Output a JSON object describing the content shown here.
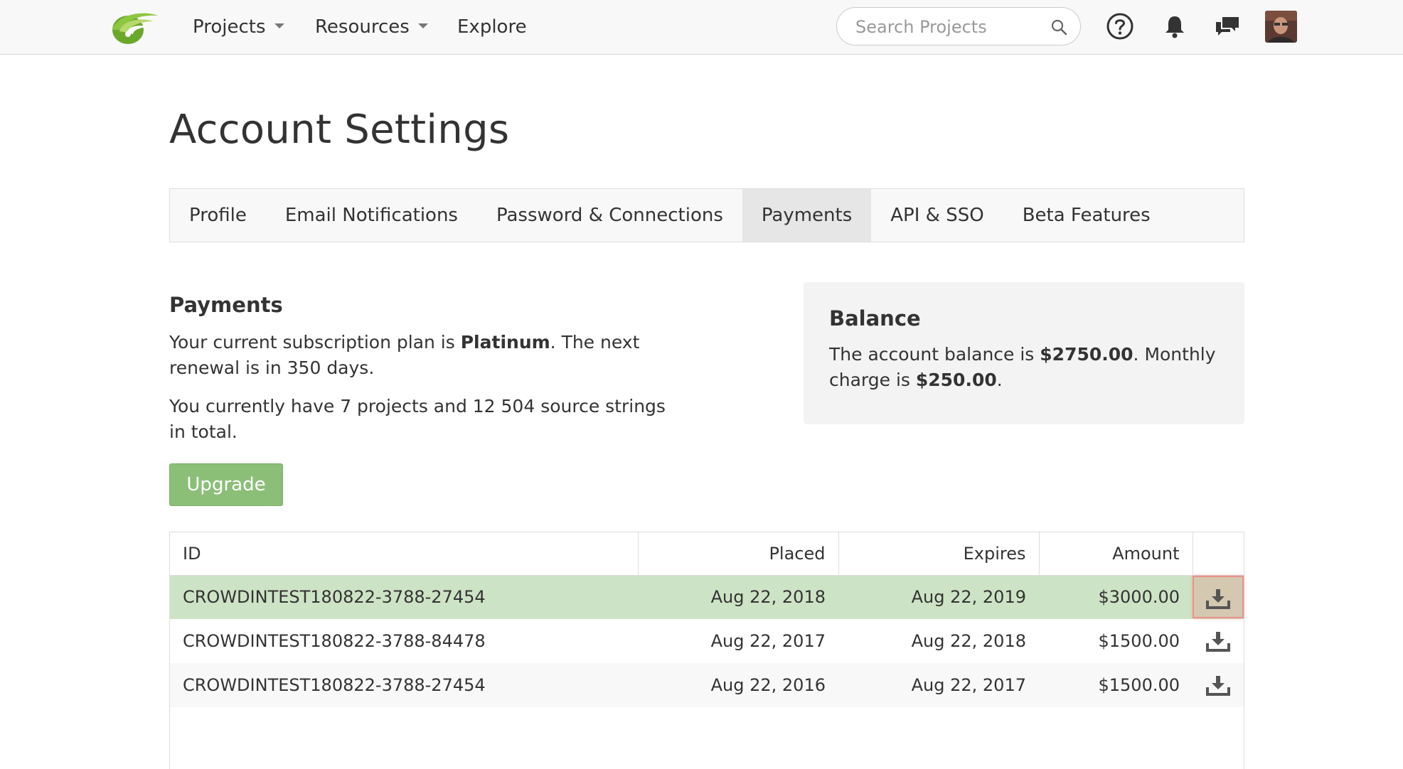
{
  "nav": {
    "projects_label": "Projects",
    "resources_label": "Resources",
    "explore_label": "Explore",
    "search_placeholder": "Search Projects",
    "logo_icon": "crowdin-logo",
    "icons": [
      "help-icon",
      "bell-icon",
      "chat-icon",
      "avatar"
    ]
  },
  "page": {
    "title": "Account Settings"
  },
  "tabs": [
    {
      "label": "Profile",
      "active": false
    },
    {
      "label": "Email Notifications",
      "active": false
    },
    {
      "label": "Password & Connections",
      "active": false
    },
    {
      "label": "Payments",
      "active": true
    },
    {
      "label": "API & SSO",
      "active": false
    },
    {
      "label": "Beta Features",
      "active": false
    }
  ],
  "payments": {
    "title": "Payments",
    "plan_prefix": "Your current subscription plan is ",
    "plan_name": "Platinum",
    "plan_suffix": ". The next renewal is in 350 days.",
    "usage_text": "You currently have 7 projects and 12 504 source strings in total.",
    "upgrade_label": "Upgrade"
  },
  "balance": {
    "title": "Balance",
    "prefix": "The account balance is ",
    "amount": "$2750.00",
    "middle": ". Monthly charge is ",
    "monthly": "$250.00",
    "suffix": "."
  },
  "table": {
    "headers": {
      "id": "ID",
      "placed": "Placed",
      "expires": "Expires",
      "amount": "Amount"
    },
    "rows": [
      {
        "id": "CROWDINTEST180822-3788-27454",
        "placed": "Aug 22, 2018",
        "expires": "Aug 22, 2019",
        "amount": "$3000.00"
      },
      {
        "id": "CROWDINTEST180822-3788-84478",
        "placed": "Aug 22, 2017",
        "expires": "Aug 22, 2018",
        "amount": "$1500.00"
      },
      {
        "id": "CROWDINTEST180822-3788-27454",
        "placed": "Aug 22, 2016",
        "expires": "Aug 22, 2017",
        "amount": "$1500.00"
      }
    ]
  },
  "colors": {
    "highlight_row": "#cde3c5",
    "upgrade_button": "#8bbf78",
    "active_tab": "#e6e6e6",
    "focus_outline": "#e8938a"
  }
}
